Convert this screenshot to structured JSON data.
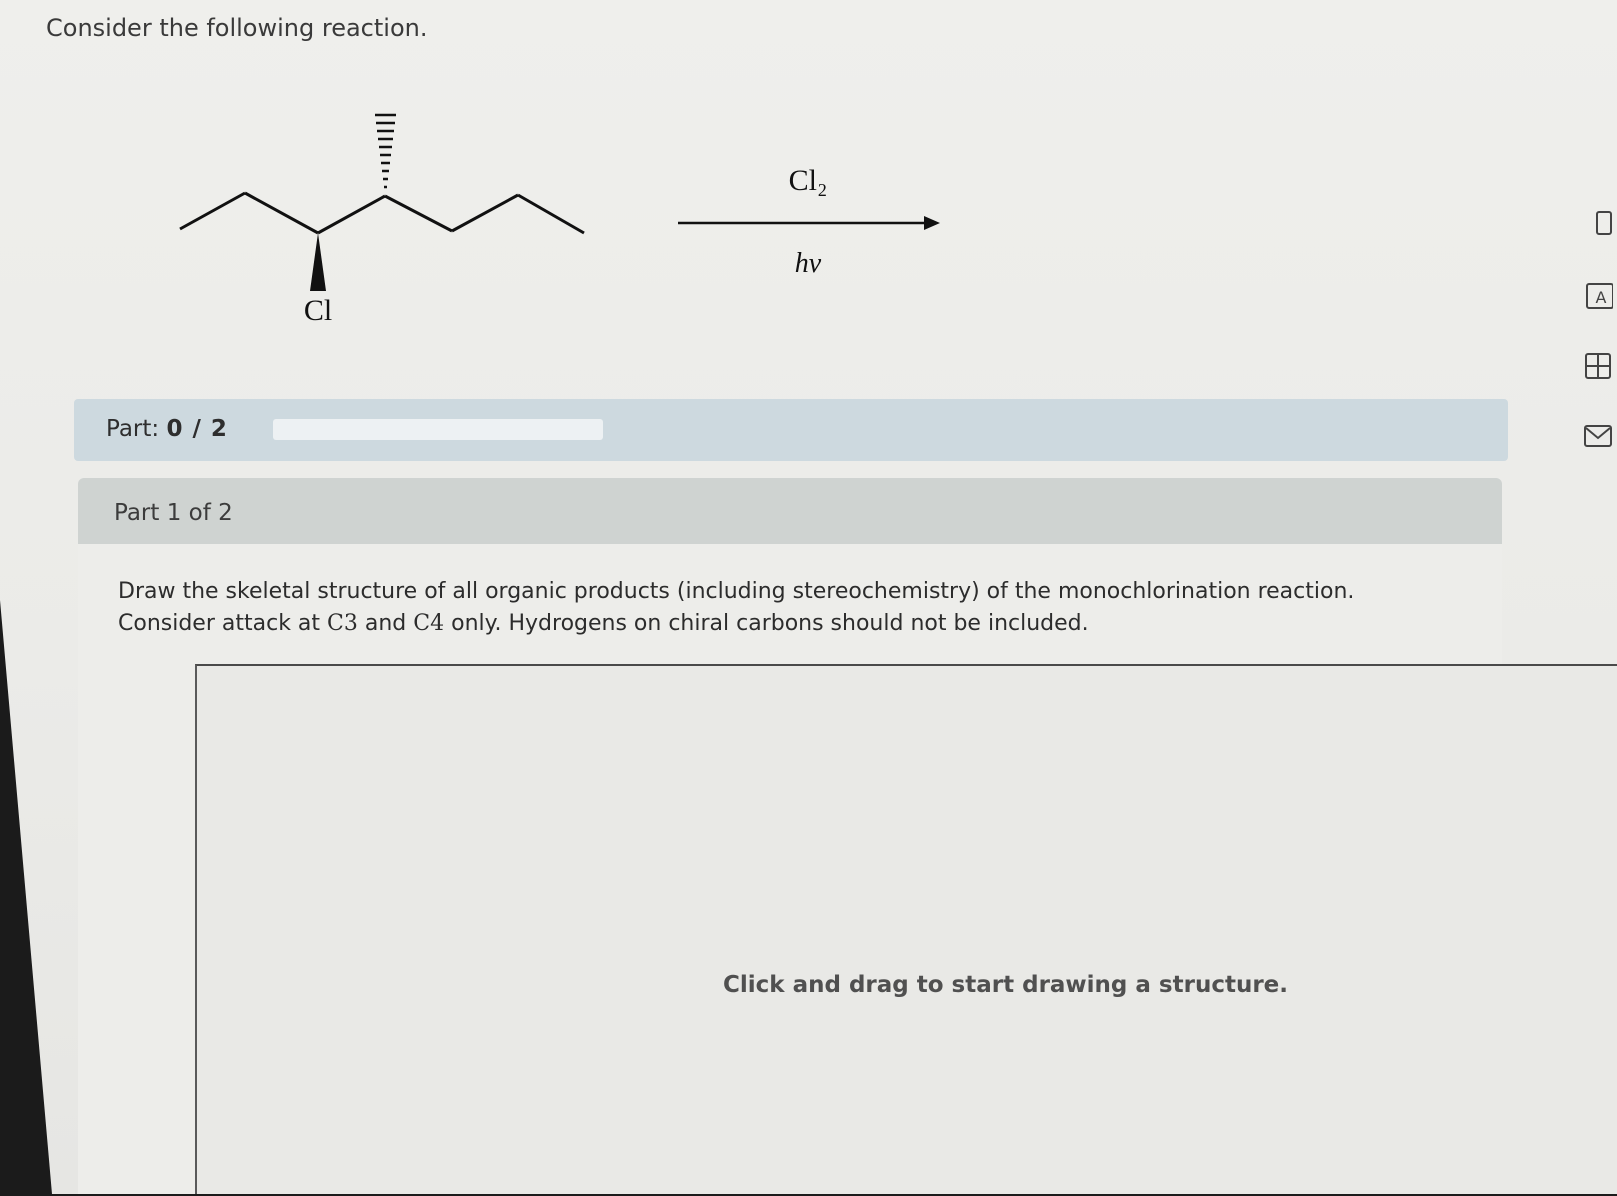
{
  "question": {
    "intro": "Consider the following reaction."
  },
  "reaction": {
    "substituent_label": "Cl",
    "reagent": "Cl₂",
    "condition": "hν"
  },
  "progress": {
    "label": "Part:",
    "value": "0 / 2",
    "fraction_complete": 0
  },
  "part": {
    "title": "Part 1 of 2",
    "instruction_line1": "Draw the skeletal structure of all organic products (including stereochemistry) of the monochlorination reaction.",
    "instruction_line2_prefix": "Consider attack at ",
    "c3": "C3",
    "and_text": " and ",
    "c4": "C4",
    "instruction_line2_suffix": " only. Hydrogens on chiral carbons should not be included."
  },
  "canvas": {
    "hint": "Click and drag to start drawing a structure."
  },
  "sidebar_tools": [
    {
      "icon": "calculator-icon"
    },
    {
      "icon": "text-tool-icon"
    },
    {
      "icon": "data-table-icon"
    },
    {
      "icon": "mail-icon"
    }
  ]
}
